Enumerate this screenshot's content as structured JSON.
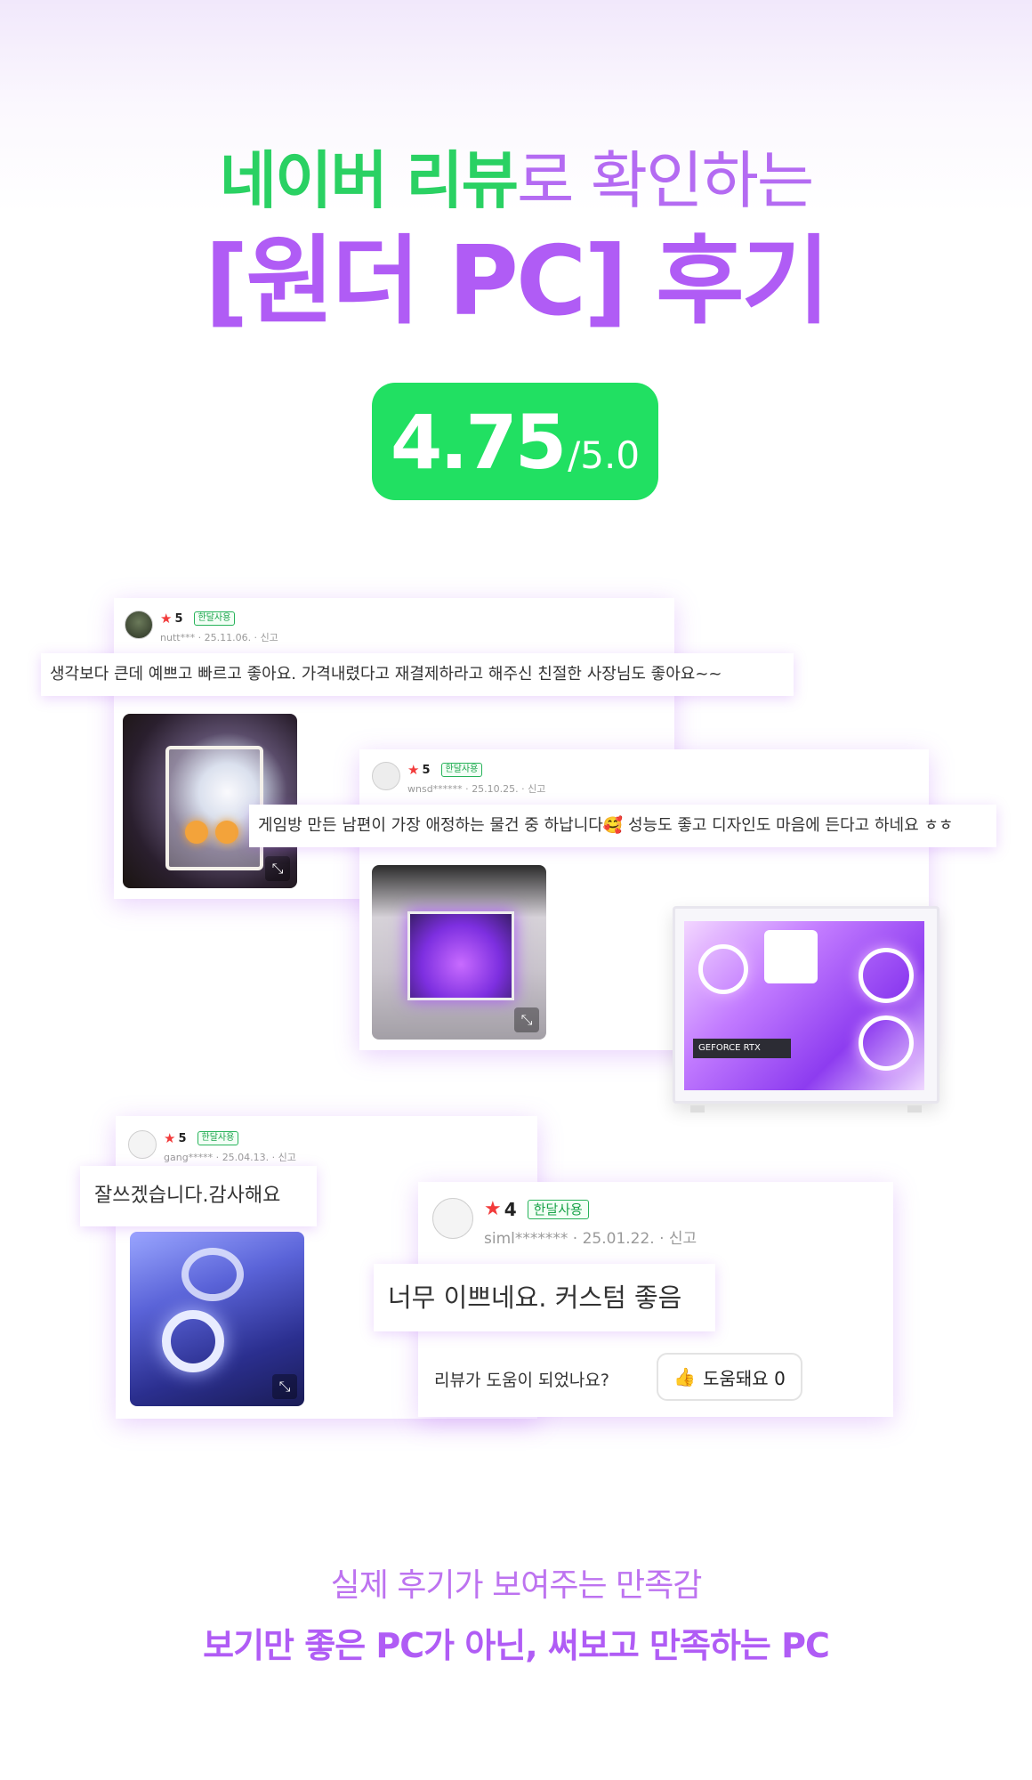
{
  "header": {
    "title_green": "네이버 리뷰",
    "title_rest": "로 확인하는",
    "title_main": "[원더 PC] 후기",
    "rating_value": "4.75",
    "rating_max": "/5.0"
  },
  "reviews": [
    {
      "score": "5",
      "badge": "한달사용",
      "user": "nutt***",
      "date": "25.11.06.",
      "report": "신고",
      "comment": "생각보다 큰데 예쁘고 빠르고 좋아요. 가격내렸다고 재결제하라고 해주신 친절한 사장님도 좋아요~~"
    },
    {
      "score": "5",
      "badge": "한달사용",
      "user": "wnsd******",
      "date": "25.10.25.",
      "report": "신고",
      "comment": "게임방 만든 남편이 가장 애정하는 물건 중 하납니다🥰 성능도 좋고 디자인도 마음에 든다고 하네요 ㅎㅎ"
    },
    {
      "score": "5",
      "badge": "한달사용",
      "user": "gang*****",
      "date": "25.04.13.",
      "report": "신고",
      "comment": "잘쓰겠습니다.감사해요"
    },
    {
      "score": "4",
      "badge": "한달사용",
      "user": "siml*******",
      "date": "25.01.22.",
      "report": "신고",
      "comment": "너무 이쁘네요. 커스텀 좋음"
    }
  ],
  "product": {
    "gpu_label": "GEFORCE RTX"
  },
  "helpful": {
    "question": "리뷰가 도움이 되었나요?",
    "button_label": "도움돼요 0"
  },
  "footer": {
    "line1": "실제 후기가 보여주는 만족감",
    "line2": "보기만 좋은 PC가 아닌, 써보고 만족하는 PC"
  },
  "colors": {
    "brand_green": "#21e062",
    "brand_purple": "#b05cf5",
    "star_red": "#f23b3b"
  },
  "icons": {
    "star": "star-icon",
    "expand": "expand-icon",
    "thumb": "thumbs-up-icon"
  }
}
